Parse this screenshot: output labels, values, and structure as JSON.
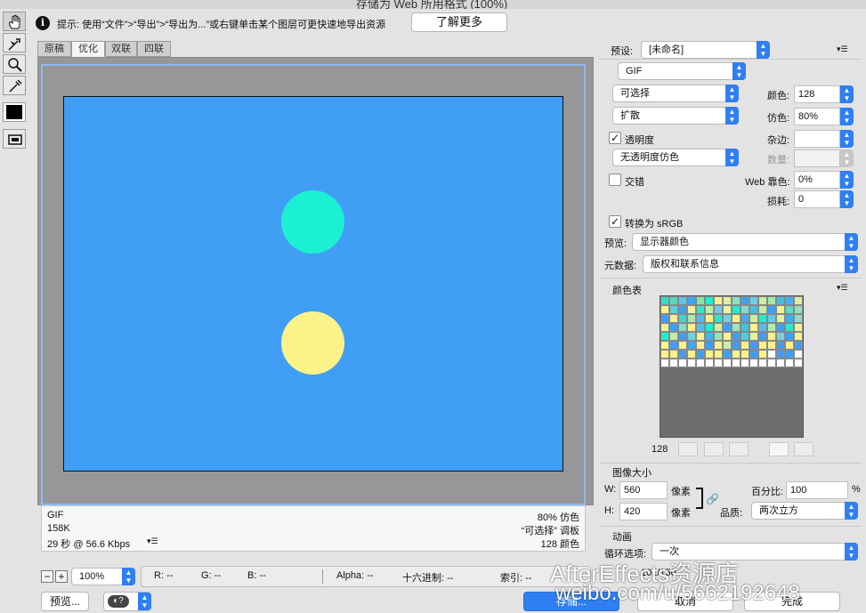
{
  "window": {
    "title": "存储为 Web 所用格式 (100%)"
  },
  "hint": {
    "text": "提示: 使用“文件”>“导出”>“导出为...”或右键单击某个图层可更快速地导出资源",
    "learn_more": "了解更多"
  },
  "tools": [
    "hand-tool-icon",
    "slice-select-icon",
    "zoom-icon",
    "eyedropper-icon",
    "eyedropper-color-swatch",
    "toggle-slices-icon"
  ],
  "tabs": [
    "原稿",
    "优化",
    "双联",
    "四联"
  ],
  "active_tab": "优化",
  "canvas": {
    "artboard_color": "#409ef5",
    "circle_top_color": "#1cf0d3",
    "circle_bottom_color": "#fbf28a"
  },
  "status": {
    "format": "GIF",
    "size": "158K",
    "time": "29 秒 @ 56.6 Kbps",
    "dither": "80% 仿色",
    "palette": "“可选择” 调板",
    "colors": "128 颜色"
  },
  "bottom": {
    "zoom": "100%",
    "r": "R: --",
    "g": "G: --",
    "b": "B: --",
    "alpha": "Alpha: --",
    "hex": "十六进制: --",
    "index": "索引: --",
    "preview_btn": "预览...",
    "save_btn": "存储...",
    "cancel_btn": "取消",
    "done_btn": "完成"
  },
  "settings": {
    "preset_label": "预设:",
    "preset_value": "[未命名]",
    "format_value": "GIF",
    "reduction_value": "可选择",
    "dither_algo_value": "扩散",
    "transparency_label": "透明度",
    "transparency_checked": true,
    "trans_dither_value": "无透明度仿色",
    "interlaced_label": "交错",
    "interlaced_checked": false,
    "colors_label": "颜色:",
    "colors_value": "128",
    "dither_label": "仿色:",
    "dither_value": "80%",
    "matte_label": "杂边:",
    "matte_value": "",
    "amount_label": "数量:",
    "amount_value": "",
    "websnap_label": "Web 靠色:",
    "websnap_value": "0%",
    "lossy_label": "损耗:",
    "lossy_value": "0",
    "srgb_label": "转换为 sRGB",
    "srgb_checked": true,
    "preview_label": "预览:",
    "preview_value": "显示器颜色",
    "metadata_label": "元数据:",
    "metadata_value": "版权和联系信息"
  },
  "color_table": {
    "title": "颜色表",
    "count": "128",
    "swatches": [
      "#2fe0c8",
      "#5ad8b8",
      "#58c8e8",
      "#3aa8f0",
      "#80e8a0",
      "#1cf0d3",
      "#fbf28a",
      "#e0f0a0",
      "#8ee0c0",
      "#40a0f0",
      "#6ad0e0",
      "#c8f0a0",
      "#a0e8b0",
      "#3cc0e0",
      "#48b0f0",
      "#d8f098",
      "#fbf28a",
      "#5ad0d8",
      "#409ef5",
      "#f4f0a0",
      "#2ee8cc",
      "#b8f0a8",
      "#70c8f0",
      "#e8f4a0",
      "#1cf0d3",
      "#88d8d0",
      "#50b8e8",
      "#c0f0a0",
      "#409ef5",
      "#f8f290",
      "#60d8c8",
      "#98e0b8",
      "#409ef5",
      "#f0f0a0",
      "#38d8d0",
      "#a8e8b0",
      "#58b8f0",
      "#fbf28a",
      "#2ce4d0",
      "#78d0e0",
      "#fbf28a",
      "#48a8f0",
      "#c8f0a0",
      "#20ecd0",
      "#68c8e8",
      "#e0f29a",
      "#3cb0f0",
      "#90dcc8",
      "#e8f29c",
      "#409ef5",
      "#84dcc8",
      "#fbf28a",
      "#50c0e8",
      "#1cf0d3",
      "#d0f0a0",
      "#409ef5",
      "#a0e4b8",
      "#38c8e0",
      "#fbf28a",
      "#60b8f0",
      "#b0ecb0",
      "#409ef5",
      "#28e8d0",
      "#f0f29a",
      "#1cf0d3",
      "#c0eeaa",
      "#409ef5",
      "#70d4d8",
      "#fbf28a",
      "#44b4ec",
      "#98e4b4",
      "#fbf28a",
      "#409ef5",
      "#54ccdc",
      "#e0f29c",
      "#409ef5",
      "#fbf28a",
      "#78d0dc",
      "#409ef5",
      "#fbf28a",
      "#fbf28a",
      "#409ef5",
      "#fbf28a",
      "#40a8f0",
      "#fbf28a",
      "#409ef5",
      "#fbf28a",
      "#c8eea8",
      "#409ef5",
      "#fbf28a",
      "#409ef5",
      "#fbf28a",
      "#fbf28a",
      "#409ef5",
      "#fbf28a",
      "#409ef5",
      "#fbf28a",
      "#fbf28a",
      "#409ef5",
      "#fbf28a",
      "#409ef5",
      "#fbf28a",
      "#fbf28a",
      "#409ef5",
      "#fbf28a",
      "#fbf28a",
      "#409ef5",
      "#fbf28a",
      "#ffffff",
      "#409ef5",
      "#409ef5",
      "#ffffff",
      "#ffffff",
      "#ffffff",
      "#ffffff",
      "#ffffff",
      "#ffffff",
      "#ffffff",
      "#ffffff",
      "#ffffff",
      "#ffffff",
      "#ffffff",
      "#ffffff",
      "#ffffff",
      "#ffffff",
      "#ffffff",
      "#ffffff",
      "#ffffff"
    ]
  },
  "image_size": {
    "title": "图像大小",
    "w_label": "W:",
    "w_value": "560",
    "h_label": "H:",
    "h_value": "420",
    "unit": "像素",
    "percent_label": "百分比:",
    "percent_value": "100",
    "percent_unit": "%",
    "quality_label": "品质:",
    "quality_value": "两次立方"
  },
  "animation": {
    "title": "动画",
    "loop_label": "循环选项:",
    "loop_value": "一次",
    "frame_counter": "101/150"
  },
  "watermark": {
    "line1": "AfterEffects资源店",
    "line2": "weibo.com/u/5662192648"
  }
}
